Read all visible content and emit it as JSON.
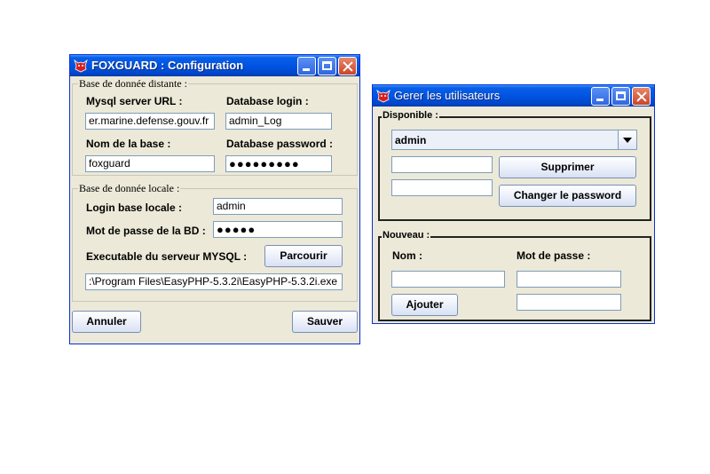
{
  "config_window": {
    "title": "FOXGUARD : Configuration",
    "remote_group": {
      "legend": "Base de donnée distante :",
      "url_label": "Mysql server URL :",
      "url_value": "er.marine.defense.gouv.fr",
      "login_label": "Database login :",
      "login_value": "admin_Log",
      "dbname_label": "Nom de la base :",
      "dbname_value": "foxguard",
      "password_label": "Database password :",
      "password_value": "●●●●●●●●●"
    },
    "local_group": {
      "legend": "Base de donnée locale :",
      "login_label": "Login base locale :",
      "login_value": "admin",
      "password_label": "Mot de passe de la BD :",
      "password_value": "●●●●●",
      "exe_label": "Executable du serveur MYSQL :",
      "browse_label": "Parcourir",
      "exe_path": ":\\Program Files\\EasyPHP-5.3.2i\\EasyPHP-5.3.2i.exe"
    },
    "cancel_label": "Annuler",
    "save_label": "Sauver"
  },
  "users_window": {
    "title": "Gerer les utilisateurs",
    "available_group": {
      "legend": "Disponible :",
      "selected_user": "admin",
      "field1_value": "",
      "field2_value": "",
      "delete_label": "Supprimer",
      "change_password_label": "Changer le password"
    },
    "new_group": {
      "legend": "Nouveau :",
      "name_label": "Nom :",
      "password_label": "Mot de passe :",
      "name_value": "",
      "password_value": "",
      "password_confirm_value": "",
      "add_label": "Ajouter"
    }
  },
  "icons": {
    "app_icon": "fox-icon",
    "minimize": "minimize-icon",
    "maximize": "maximize-icon",
    "close": "close-icon"
  },
  "colors": {
    "titlebar": "#0054e3",
    "window_bg": "#ece9d8",
    "close_button": "#c9452a"
  }
}
